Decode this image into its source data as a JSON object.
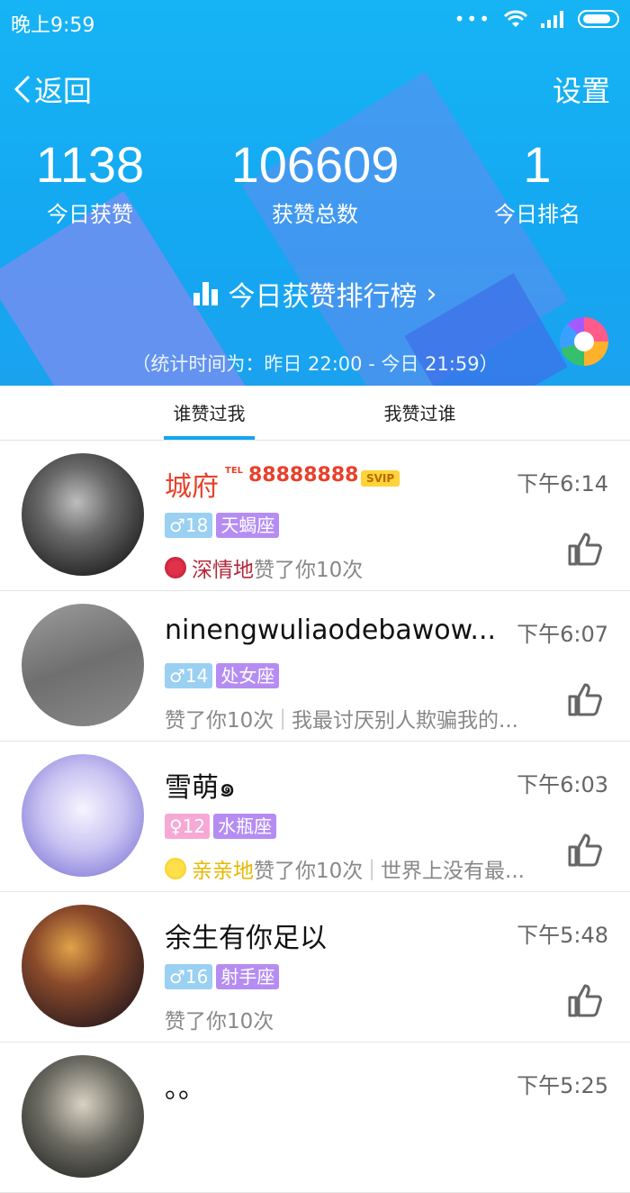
{
  "status_bar": {
    "time": "晚上9:59",
    "dots": "•••"
  },
  "nav": {
    "back_label": "返回",
    "settings_label": "设置"
  },
  "stats": [
    {
      "value": "1138",
      "label": "今日获赞"
    },
    {
      "value": "106609",
      "label": "获赞总数"
    },
    {
      "value": "1",
      "label": "今日排名"
    }
  ],
  "rank_link": {
    "label": "今日获赞排行榜",
    "arrow": "›"
  },
  "period_text": "（统计时间为：昨日 22:00 - 今日 21:59）",
  "tabs": [
    {
      "label": "谁赞过我",
      "active": true
    },
    {
      "label": "我赞过谁",
      "active": false
    }
  ],
  "rows": [
    {
      "name": "城府",
      "tel_sup": "TEL",
      "tel_number": "88888888",
      "vip_badge": "SVIP",
      "time": "下午6:14",
      "gender_age": "♂18",
      "constellation": "天蝎座",
      "like_style": "深情地",
      "like_text": "赞了你10次",
      "extra": ""
    },
    {
      "name": "ninengwuliaodebawow...",
      "time": "下午6:07",
      "gender_age": "♂14",
      "constellation": "处女座",
      "like_text": "赞了你10次",
      "separator": "|",
      "extra": "我最讨厌别人欺骗我的..."
    },
    {
      "name": "雪萌๑",
      "time": "下午6:03",
      "gender_age": "♀12",
      "constellation": "水瓶座",
      "like_style": "亲亲地",
      "like_text": "赞了你10次",
      "separator": "|",
      "extra": "世界上没有最..."
    },
    {
      "name": "余生有你足以",
      "time": "下午5:48",
      "gender_age": "♂16",
      "constellation": "射手座",
      "like_text": "赞了你10次",
      "extra": ""
    },
    {
      "name": "。。",
      "time": "下午5:25"
    }
  ],
  "colors": {
    "header": "#16b4f4",
    "tab_indicator": "#12a6f0",
    "name_highlight": "#e8402a"
  }
}
